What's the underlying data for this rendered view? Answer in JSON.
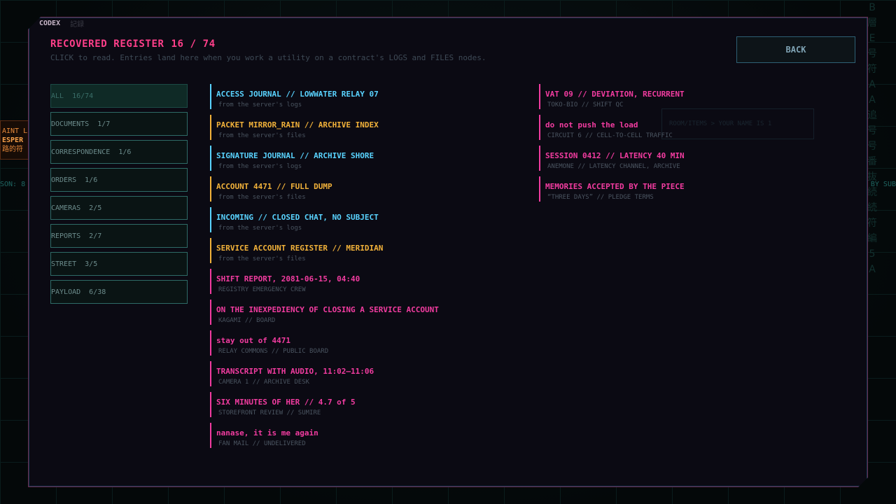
{
  "colors": {
    "log": "#59d3ff",
    "file": "#f2b23a",
    "doc": "#f23ca0"
  },
  "side": {
    "tag_line1": "AINT L",
    "tag_line2": "ESPER",
    "tag_line3": "路的符",
    "reason_left": "SON: 8",
    "reason_right": "BY SUB"
  },
  "tabs": {
    "codex": "CODEX",
    "kanji": "記録"
  },
  "header": {
    "title": "RECOVERED REGISTER",
    "count": "16 / 74",
    "subtitle": "CLICK to read.  Entries land here when you work a utility on a contract's LOGS and FILES nodes."
  },
  "back_label": "BACK",
  "ghost_card": "ROOM/ITEMS > YOUR NAME IS 1",
  "filters": [
    {
      "label": "ALL  16/74",
      "active": true
    },
    {
      "label": "DOCUMENTS  1/7",
      "active": false
    },
    {
      "label": "CORRESPONDENCE  1/6",
      "active": false
    },
    {
      "label": "ORDERS  1/6",
      "active": false
    },
    {
      "label": "CAMERAS  2/5",
      "active": false
    },
    {
      "label": "REPORTS  2/7",
      "active": false
    },
    {
      "label": "STREET  3/5",
      "active": false
    },
    {
      "label": "PAYLOAD  6/38",
      "active": false
    }
  ],
  "entries_left": [
    {
      "title": "ACCESS JOURNAL // LOWWATER RELAY 07",
      "sub": "from the server's logs",
      "kind": "log"
    },
    {
      "title": "PACKET MIRROR_RAIN // ARCHIVE INDEX",
      "sub": "from the server's files",
      "kind": "file"
    },
    {
      "title": "SIGNATURE JOURNAL // ARCHIVE SHORE",
      "sub": "from the server's logs",
      "kind": "log"
    },
    {
      "title": "ACCOUNT 4471 // FULL DUMP",
      "sub": "from the server's files",
      "kind": "file"
    },
    {
      "title": "INCOMING // CLOSED CHAT, NO SUBJECT",
      "sub": "from the server's logs",
      "kind": "log"
    },
    {
      "title": "SERVICE ACCOUNT REGISTER // MERIDIAN",
      "sub": "from the server's files",
      "kind": "file"
    },
    {
      "title": "SHIFT REPORT, 2081-06-15, 04:40",
      "sub": "REGISTRY EMERGENCY CREW",
      "kind": "doc"
    },
    {
      "title": "ON THE INEXPEDIENCY OF CLOSING A SERVICE ACCOUNT",
      "sub": "KAGAMI // BOARD",
      "kind": "doc"
    },
    {
      "title": "stay out of 4471",
      "sub": "RELAY COMMONS // PUBLIC BOARD",
      "kind": "doc"
    },
    {
      "title": "TRANSCRIPT WITH AUDIO, 11:02–11:06",
      "sub": "CAMERA 1 // ARCHIVE DESK",
      "kind": "doc"
    },
    {
      "title": "SIX MINUTES OF HER // 4.7 of 5",
      "sub": "STOREFRONT REVIEW // SUMIRE",
      "kind": "doc"
    },
    {
      "title": "nanase, it is me again",
      "sub": "FAN MAIL // UNDELIVERED",
      "kind": "doc"
    }
  ],
  "entries_right": [
    {
      "title": "VAT 09 // DEVIATION, RECURRENT",
      "sub": "TOKO-BIO // SHIFT QC",
      "kind": "doc"
    },
    {
      "title": "do not push the load",
      "sub": "CIRCUIT 6 // CELL-TO-CELL TRAFFIC",
      "kind": "doc"
    },
    {
      "title": "SESSION 0412 // LATENCY 40 MIN",
      "sub": "ANEMONE // LATENCY CHANNEL, ARCHIVE",
      "kind": "doc"
    },
    {
      "title": "MEMORIES ACCEPTED BY THE PIECE",
      "sub": "“THREE DAYS” // PLEDGE TERMS",
      "kind": "doc"
    }
  ]
}
